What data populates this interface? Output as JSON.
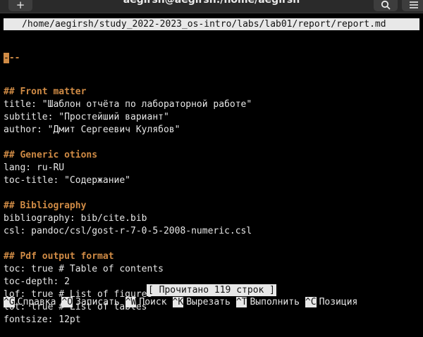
{
  "window": {
    "title": "aegirsh@aegirsh:/home/aegirsh",
    "new_tab_icon": "plus-icon",
    "search_icon": "search-icon",
    "menu_icon": "hamburger-menu-icon"
  },
  "editor": {
    "file_path": "/home/aegirsh/study_2022-2023_os-intro/labs/lab01/report/report.md",
    "first_line_cursor": "-",
    "first_line_rest": "--",
    "lines": [
      {
        "text": "## Front matter",
        "kind": "heading"
      },
      {
        "text": "title: \"Шаблон отчёта по лабораторной работе\"",
        "kind": "text"
      },
      {
        "text": "subtitle: \"Простейший вариант\"",
        "kind": "text"
      },
      {
        "text": "author: \"Дмит Сергеевич Кулябов\"",
        "kind": "text"
      },
      {
        "text": "",
        "kind": "text"
      },
      {
        "text": "## Generic otions",
        "kind": "heading"
      },
      {
        "text": "lang: ru-RU",
        "kind": "text"
      },
      {
        "text": "toc-title: \"Содержание\"",
        "kind": "text"
      },
      {
        "text": "",
        "kind": "text"
      },
      {
        "text": "## Bibliography",
        "kind": "heading"
      },
      {
        "text": "bibliography: bib/cite.bib",
        "kind": "text"
      },
      {
        "text": "csl: pandoc/csl/gost-r-7-0-5-2008-numeric.csl",
        "kind": "text"
      },
      {
        "text": "",
        "kind": "text"
      },
      {
        "text": "## Pdf output format",
        "kind": "heading"
      },
      {
        "text": "toc: true # Table of contents",
        "kind": "text"
      },
      {
        "text": "toc-depth: 2",
        "kind": "text"
      },
      {
        "text": "lof: true # List of figures",
        "kind": "text"
      },
      {
        "text": "lot: true # List of tables",
        "kind": "text"
      },
      {
        "text": "fontsize: 12pt",
        "kind": "text"
      }
    ],
    "heading_color": "#d08b45"
  },
  "status": {
    "message": "[ Прочитано 119 строк ]"
  },
  "shortcuts": [
    {
      "key": "^G",
      "label": "Справка"
    },
    {
      "key": "^O",
      "label": "Записать"
    },
    {
      "key": "^W",
      "label": "Поиск"
    },
    {
      "key": "^K",
      "label": "Вырезать"
    },
    {
      "key": "^T",
      "label": "Выполнить"
    },
    {
      "key": "^C",
      "label": "Позиция"
    }
  ]
}
